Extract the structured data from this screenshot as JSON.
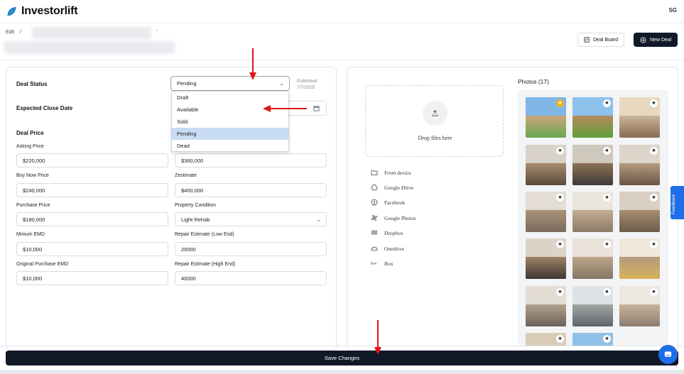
{
  "app": {
    "name": "Investorlift",
    "user_initials": "SG"
  },
  "breadcrumb": {
    "edit": "Edit",
    "sep": "/"
  },
  "header": {
    "deal_board": "Deal Board",
    "new_deal": "New Deal"
  },
  "deal": {
    "status_label": "Deal Status",
    "status_value": "Pending",
    "published_label": "Published",
    "published_date": "7/7/2025",
    "close_date_label": "Expected Close Date",
    "price_heading": "Deal Price",
    "status_options": [
      "Draft",
      "Available",
      "Sold",
      "Pending",
      "Dead"
    ],
    "selected_option": "Pending",
    "fields": {
      "asking_price": {
        "label": "Asking Price",
        "value": "$220,000"
      },
      "arv": {
        "value": "$360,000"
      },
      "buy_now": {
        "label": "Buy Now Price",
        "value": "$240,000"
      },
      "zestimate": {
        "label": "Zestimate",
        "value": "$400,000"
      },
      "purchase_price": {
        "label": "Purchase Price",
        "value": "$180,000"
      },
      "property_condition": {
        "label": "Property Condition",
        "value": "Light Rehab"
      },
      "min_emd": {
        "label": "Minium EMD",
        "value": "$10,000"
      },
      "repair_low": {
        "label": "Repair Estimate (Low End)",
        "value": "20000"
      },
      "orig_emd": {
        "label": "Original Purchase EMD",
        "value": "$10,000"
      },
      "repair_high": {
        "label": "Repair Estimate (High End)",
        "value": "40000"
      }
    }
  },
  "upload": {
    "drop_text": "Drop files here",
    "sources": [
      {
        "label": "From device",
        "icon": "folder-icon"
      },
      {
        "label": "Google Drive",
        "icon": "google-drive-icon"
      },
      {
        "label": "Facebook",
        "icon": "facebook-icon"
      },
      {
        "label": "Google Photos",
        "icon": "google-photos-icon"
      },
      {
        "label": "Dropbox",
        "icon": "dropbox-icon"
      },
      {
        "label": "Onedrive",
        "icon": "onedrive-icon"
      },
      {
        "label": "Box",
        "icon": "box-icon"
      }
    ]
  },
  "photos": {
    "title": "Photos (17)",
    "count": 17,
    "featured_index": 0
  },
  "feedback_label": "Feedback",
  "save_label": "Save Changes",
  "colors": {
    "accent": "#1d6ee8",
    "dark": "#111827",
    "star_featured": "#f2b31e",
    "annotation_arrow": "#e01414"
  }
}
